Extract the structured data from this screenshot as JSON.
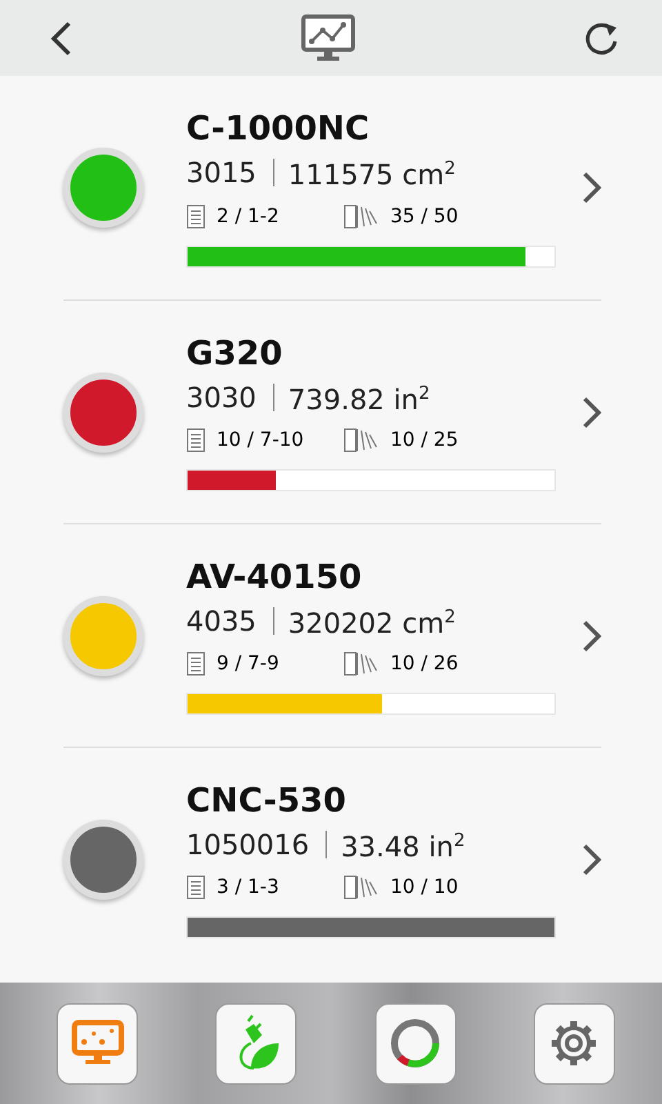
{
  "machines": [
    {
      "name": "C-1000NC",
      "count": "3015",
      "area": "111575 cm$^{2}$",
      "jobs": "2 / 1-2",
      "sheets": "35 / 50",
      "level": 0.92,
      "color": "#22c014"
    },
    {
      "name": "G320",
      "count": "3030",
      "area": "739.82 in$^{2}$",
      "jobs": "10 / 7-10",
      "sheets": "10 / 25",
      "level": 0.24,
      "color": "#d0192a"
    },
    {
      "name": "AV-40150",
      "count": "4035",
      "area": "320202 cm$^{2}$",
      "jobs": "9 / 7-9",
      "sheets": "10 / 26",
      "level": 0.53,
      "color": "#f5c800"
    },
    {
      "name": "CNC-530",
      "count": "1050016",
      "area": "33.48 in$^{2}$",
      "jobs": "3 / 1-3",
      "sheets": "10 / 10",
      "level": 1.0,
      "color": "#666666"
    }
  ]
}
